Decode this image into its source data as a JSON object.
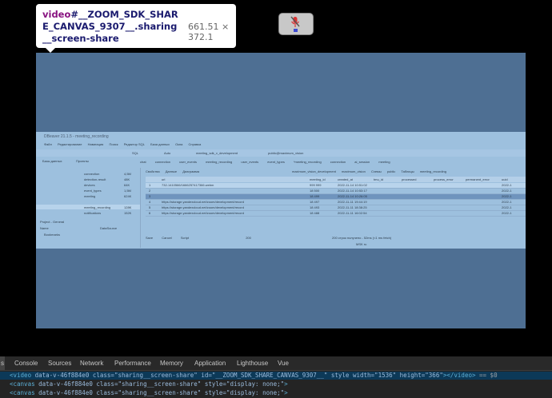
{
  "tooltip": {
    "tag": "video",
    "selector": "#__ZOOM_SDK_SHARE_CANVAS_9307__.sharing__screen-share",
    "size": "661.51 × 372.1"
  },
  "share": {
    "window_title": "DBeaver 21.1.5 - meeting_recording",
    "menu": [
      "Файл",
      "Редактирование",
      "Навигация",
      "Поиск",
      "Редактор SQL",
      "База данных",
      "Окна",
      "Справка"
    ],
    "toolbar": [
      "SQL",
      "Auto",
      "meeting_sdk_v_development",
      "public@maximum_vision"
    ],
    "tabs": [
      "chat",
      "connection",
      "user_events",
      "meeting_recording",
      "user_events",
      "event_types",
      "*meeting_recording",
      "connection",
      "ai_session",
      "meeting"
    ],
    "db_panel_label": "Базы данных",
    "projects_label": "Проекты",
    "subtabs": [
      "Свойства",
      "Данные",
      "Диаграмма"
    ],
    "breadcrumb": [
      "maximum_vision_development",
      "maximum_vision",
      "Схемы",
      "public",
      "Таблицы",
      "meeting_recording"
    ],
    "tree": [
      {
        "name": "connection",
        "size": "4,5M"
      },
      {
        "name": "detection-result",
        "size": "48K"
      },
      {
        "name": "devices",
        "size": "64K"
      },
      {
        "name": "event_types",
        "size": "1,5M"
      },
      {
        "name": "meeting",
        "size": "624K"
      },
      {
        "name": "meeting_recording",
        "size": "128K"
      },
      {
        "name": "notifications",
        "size": "152K"
      }
    ],
    "project_header": "Project - General",
    "project_cols": [
      "Name",
      "DataSource"
    ],
    "project_row": "Bookmarks",
    "grid_columns": [
      "url",
      "meeting_id",
      "created_at",
      "tmu_id",
      "processed",
      "process_error",
      "permanent_error",
      "uuid"
    ],
    "grid_rows": [
      {
        "num": "1",
        "url": "732-1410566/1666257417366.webm",
        "meeting_id": "999 999",
        "created": "2022-11-14 10:51:02",
        "uuid": "2022-1"
      },
      {
        "num": "2",
        "url": "",
        "meeting_id": "18 500",
        "created": "2022-11-14 10:53:17",
        "uuid": "2022-1"
      },
      {
        "num": "3",
        "url": "",
        "meeting_id": "18 499",
        "created": "2022-11-14 10:26:05",
        "uuid": "2022-1"
      },
      {
        "num": "4",
        "url": "https://storage.yandexcloud.net/zoom/development/record",
        "meeting_id": "18 497",
        "created": "2022-11-11 19:44:19",
        "uuid": "2022-1"
      },
      {
        "num": "5",
        "url": "https://storage.yandexcloud.net/zoom/development/record",
        "meeting_id": "18 493",
        "created": "2022-11-11 18:38:25",
        "uuid": "2022-1"
      },
      {
        "num": "6",
        "url": "https://storage.yandexcloud.net/zoom/development/record",
        "meeting_id": "18 488",
        "created": "2022-11-11 16:02:54",
        "uuid": "2022-1"
      }
    ],
    "bottom_actions": [
      "Save",
      "Cancel",
      "Script"
    ],
    "page_size": "200",
    "rows_status": "200 строк получено - 52ms (<1 ms fetch)",
    "status_locale": "MSK  ru"
  },
  "devtools": {
    "tabs": [
      "s",
      "Console",
      "Sources",
      "Network",
      "Performance",
      "Memory",
      "Application",
      "Lighthouse",
      "Vue"
    ],
    "lines": [
      {
        "tag": "video",
        "attrs": "data-v-46f884e0 class=\"sharing__screen-share\" id=\"__ZOOM_SDK_SHARE_CANVAS_9307__\" style width=\"1536\" height=\"366\"",
        "close": "></video>",
        "suffix": " == $0"
      },
      {
        "tag": "canvas",
        "attrs": "data-v-46f884e0 class=\"sharing__screen-share\" style=\"display: none;\"",
        "close": ">",
        "suffix": ""
      },
      {
        "tag": "canvas",
        "attrs": "data-v-46f884e0 class=\"sharing__screen-share\" style=\"display: none;\"",
        "close": ">",
        "suffix": ""
      }
    ]
  }
}
